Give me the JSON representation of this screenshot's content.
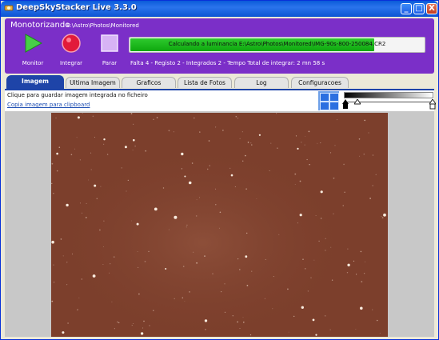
{
  "window": {
    "title": "DeepSkyStacker Live 3.3.0",
    "minimize_glyph": "_",
    "maximize_glyph": "□",
    "close_glyph": "X"
  },
  "status_panel": {
    "mode_label": "Monotorizando",
    "monitored_path": "E:\\Astro\\Photos\\Monitored",
    "buttons": [
      {
        "label": "Monitor",
        "icon": "play-icon"
      },
      {
        "label": "Integrar",
        "icon": "record-icon"
      },
      {
        "label": "Parar",
        "icon": "stop-icon"
      }
    ],
    "progress": {
      "text": "Calculando a luminancia E:\\Astro\\Photos\\Monitored\\IMG-90s-800-250084.CR2",
      "fraction": 0.83
    },
    "stats": "Falta 4 - Registo 2 - Integrados 2 - Tempo Total de integrar: 2 mn 58 s"
  },
  "tabs": [
    {
      "label": "Imagem Integrada",
      "active": true
    },
    {
      "label": "Ultima Imagem",
      "active": false
    },
    {
      "label": "Graficos",
      "active": false
    },
    {
      "label": "Lista de Fotos",
      "active": false
    },
    {
      "label": "Log",
      "active": false
    },
    {
      "label": "Configuracoes",
      "active": false
    }
  ],
  "info": {
    "save_hint": "Clique para guardar imagem integrada no ficheiro",
    "copy_link": "Copia imagem para clipboard"
  },
  "colors": {
    "panel": "#7b2fc8",
    "progress_fill": "#17b417",
    "sky": "#7c3f2c"
  }
}
